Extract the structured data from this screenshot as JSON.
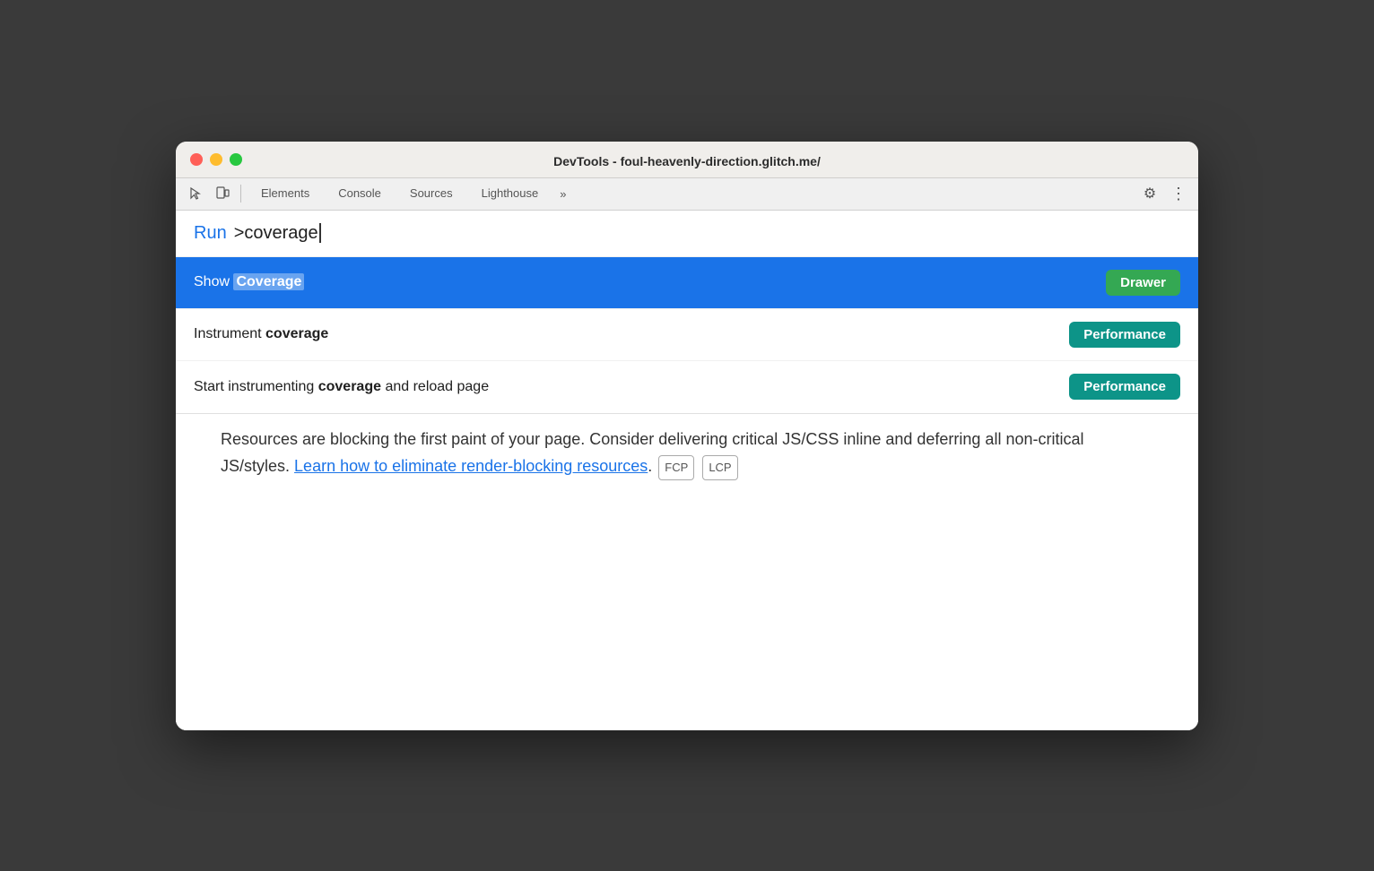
{
  "window": {
    "title": "DevTools - foul-heavenly-direction.glitch.me/"
  },
  "toolbar": {
    "tabs": [
      {
        "id": "elements",
        "label": "Elements"
      },
      {
        "id": "console",
        "label": "Console"
      },
      {
        "id": "sources",
        "label": "Sources"
      },
      {
        "id": "lighthouse",
        "label": "Lighthouse"
      }
    ],
    "more_icon": "»",
    "settings_icon": "⚙",
    "menu_icon": "⋮"
  },
  "command_palette": {
    "run_label": "Run",
    "input_text": ">coverage",
    "suggestions": [
      {
        "id": "show-coverage",
        "text_prefix": "Show ",
        "text_highlight": "Coverage",
        "text_suffix": "",
        "badge_label": "Drawer",
        "badge_type": "drawer",
        "active": true
      },
      {
        "id": "instrument-coverage",
        "text_prefix": "Instrument ",
        "text_highlight": "coverage",
        "text_suffix": "",
        "badge_label": "Performance",
        "badge_type": "performance",
        "active": false
      },
      {
        "id": "start-instrument-coverage",
        "text_prefix": "Start instrumenting ",
        "text_highlight": "coverage",
        "text_suffix": " and reload page",
        "badge_label": "Performance",
        "badge_type": "performance",
        "active": false
      }
    ]
  },
  "page_content": {
    "text": "Resources are blocking the first paint of your page. Consider delivering critical JS/CSS inline and deferring all non-critical JS/styles.",
    "link_text": "Learn how to eliminate render-blocking resources",
    "link_suffix": ".",
    "tags": [
      "FCP",
      "LCP"
    ]
  }
}
